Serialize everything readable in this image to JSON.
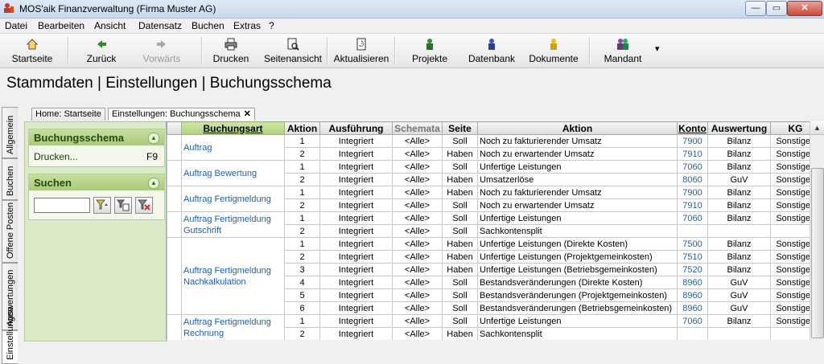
{
  "window": {
    "title": "MOS'aik Finanzverwaltung (Firma Muster AG)",
    "min": "—",
    "max": "▭",
    "close": "✕"
  },
  "menu": [
    "Datei",
    "Bearbeiten",
    "Ansicht",
    "Datensatz",
    "Buchen",
    "Extras",
    "?"
  ],
  "toolbar": {
    "startseite": "Startseite",
    "zurueck": "Zurück",
    "vorwaerts": "Vorwärts",
    "drucken": "Drucken",
    "seitenansicht": "Seitenansicht",
    "aktualisieren": "Aktualisieren",
    "projekte": "Projekte",
    "datenbank": "Datenbank",
    "dokumente": "Dokumente",
    "mandant": "Mandant",
    "more": "▾"
  },
  "heading": "Stammdaten | Einstellungen | Buchungsschema",
  "vtabs": [
    "Allgemein",
    "Buchen",
    "Offene Posten",
    "Auswertungen",
    "Einstellungen"
  ],
  "doctabs": {
    "home": "Home: Startseite",
    "current": "Einstellungen: Buchungsschema",
    "close": "✕"
  },
  "sidebar": {
    "panel1": {
      "title": "Buchungsschema",
      "item": "Drucken...",
      "shortcut": "F9",
      "collapse": "▲"
    },
    "panel2": {
      "title": "Suchen",
      "collapse": "▲",
      "search_value": ""
    }
  },
  "grid": {
    "headers": [
      "Buchungsart",
      "Aktion",
      "Ausführung",
      "Schemata",
      "Seite",
      "Aktion",
      "Konto",
      "Auswertung",
      "KG"
    ],
    "groups": [
      {
        "name": "Auftrag",
        "rows": [
          [
            "1",
            "Integriert",
            "<Alle>",
            "Soll",
            "Noch zu fakturierender Umsatz",
            "7900",
            "Bilanz",
            "Sonstiges"
          ],
          [
            "2",
            "Integriert",
            "<Alle>",
            "Haben",
            "Noch zu erwartender Umsatz",
            "7910",
            "Bilanz",
            "Sonstiges"
          ]
        ]
      },
      {
        "name": "Auftrag Bewertung",
        "rows": [
          [
            "1",
            "Integriert",
            "<Alle>",
            "Soll",
            "Unfertige Leistungen",
            "7060",
            "Bilanz",
            "Sonstiges"
          ],
          [
            "2",
            "Integriert",
            "<Alle>",
            "Haben",
            "Umsatzerlöse",
            "8060",
            "GuV",
            "Sonstiges"
          ]
        ]
      },
      {
        "name": "Auftrag Fertigmeldung",
        "rows": [
          [
            "1",
            "Integriert",
            "<Alle>",
            "Haben",
            "Noch zu fakturierender Umsatz",
            "7900",
            "Bilanz",
            "Sonstiges"
          ],
          [
            "2",
            "Integriert",
            "<Alle>",
            "Soll",
            "Noch zu erwartender Umsatz",
            "7910",
            "Bilanz",
            "Sonstiges"
          ]
        ]
      },
      {
        "name": "Auftrag Fertigmeldung Gutschrift",
        "rows": [
          [
            "1",
            "Integriert",
            "<Alle>",
            "Soll",
            "Unfertige Leistungen",
            "7060",
            "Bilanz",
            "Sonstiges"
          ],
          [
            "2",
            "Integriert",
            "<Alle>",
            "Soll",
            "Sachkontensplit",
            "",
            "",
            ""
          ]
        ]
      },
      {
        "name": "Auftrag Fertigmeldung Nachkalkulation",
        "rows": [
          [
            "1",
            "Integriert",
            "<Alle>",
            "Haben",
            "Unfertige Leistungen (Direkte Kosten)",
            "7500",
            "Bilanz",
            "Sonstiges"
          ],
          [
            "2",
            "Integriert",
            "<Alle>",
            "Haben",
            "Unfertige Leistungen (Projektgemeinkosten)",
            "7510",
            "Bilanz",
            "Sonstiges"
          ],
          [
            "3",
            "Integriert",
            "<Alle>",
            "Haben",
            "Unfertige Leistungen (Betriebsgemeinkosten)",
            "7520",
            "Bilanz",
            "Sonstiges"
          ],
          [
            "4",
            "Integriert",
            "<Alle>",
            "Soll",
            "Bestandsveränderungen (Direkte Kosten)",
            "8960",
            "GuV",
            "Sonstiges"
          ],
          [
            "5",
            "Integriert",
            "<Alle>",
            "Soll",
            "Bestandsveränderungen (Projektgemeinkosten)",
            "8960",
            "GuV",
            "Sonstiges"
          ],
          [
            "6",
            "Integriert",
            "<Alle>",
            "Soll",
            "Bestandsveränderungen (Betriebsgemeinkosten)",
            "8960",
            "GuV",
            "Sonstiges"
          ]
        ]
      },
      {
        "name": "Auftrag Fertigmeldung Rechnung",
        "rows": [
          [
            "1",
            "Integriert",
            "<Alle>",
            "Soll",
            "Unfertige Leistungen",
            "7060",
            "Bilanz",
            "Sonstiges"
          ],
          [
            "2",
            "Integriert",
            "<Alle>",
            "Haben",
            "Sachkontensplit",
            "",
            "",
            ""
          ]
        ]
      }
    ]
  },
  "scroll": {
    "up": "▲"
  },
  "colors": {
    "sidebar_bg": "#dcebc7",
    "link_blue": "#1f5fb3",
    "header_green": "#aed17d"
  }
}
